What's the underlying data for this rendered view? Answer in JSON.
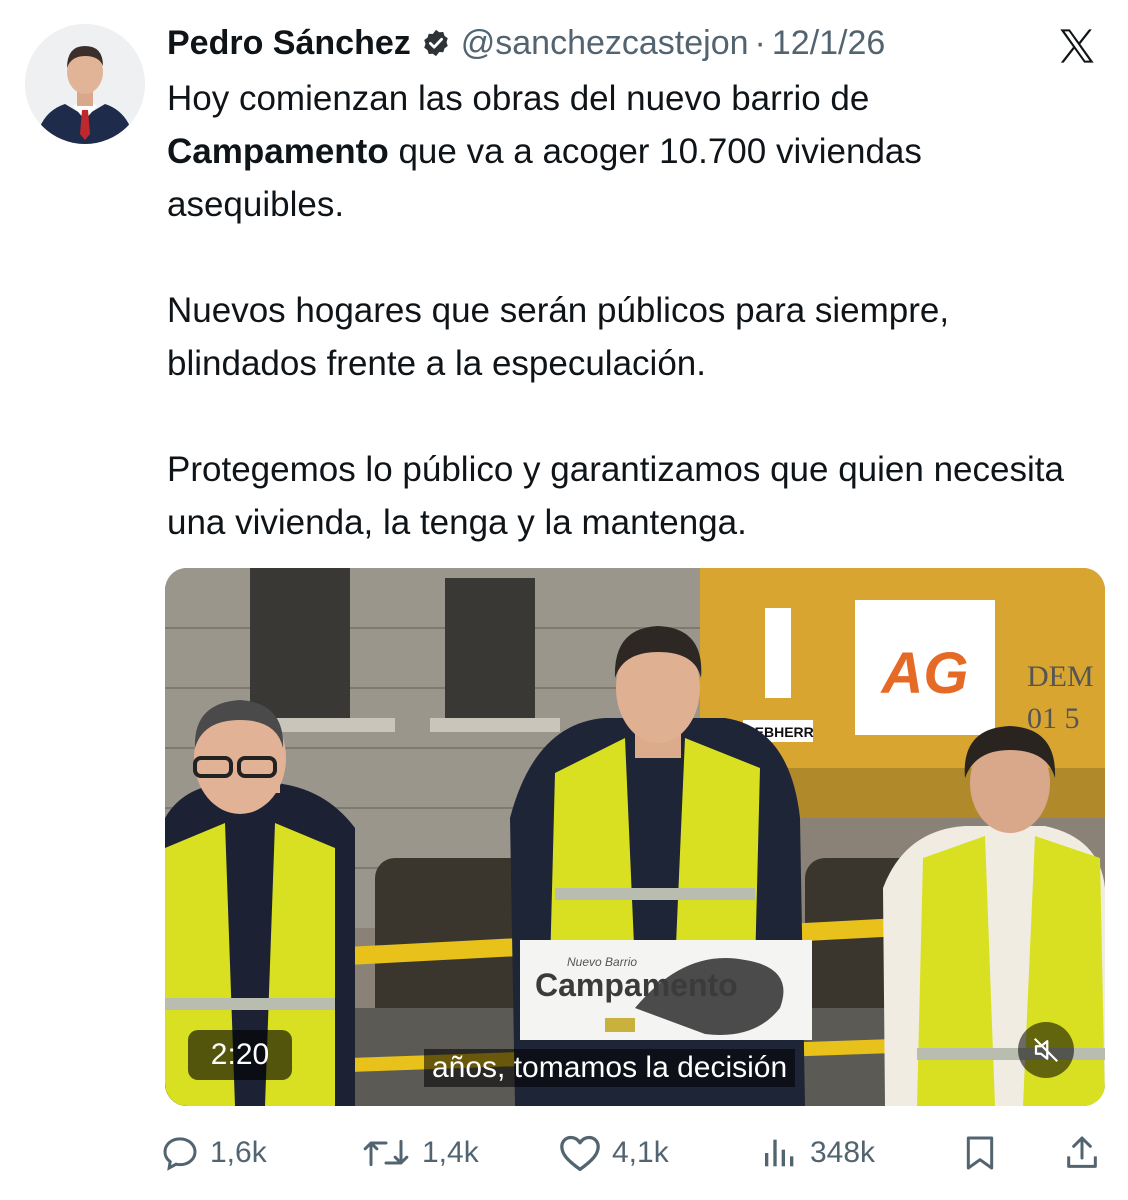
{
  "author": {
    "name": "Pedro Sánchez",
    "handle": "@sanchezcastejon",
    "separator": "·",
    "date": "12/1/26"
  },
  "icons": {
    "verified": "verified-badge-icon",
    "platform": "x-logo-icon",
    "reply": "reply-icon",
    "retweet": "retweet-icon",
    "like": "like-icon",
    "views": "views-icon",
    "bookmark": "bookmark-icon",
    "share": "share-icon",
    "mute": "mute-icon"
  },
  "tweet": {
    "p1_a": "Hoy comienzan las obras del nuevo barrio de ",
    "p1_bold": "Campamento",
    "p1_b": " que va a acoger 10.700 viviendas asequibles.",
    "p2": "Nuevos hogares que serán públicos para siempre, blindados frente a la especulación.",
    "p3": "Protegemos lo público y garantizamos que quien necesita una vivienda, la tenga y la mantenga."
  },
  "media": {
    "duration": "2:20",
    "subtitle": "años, tomamos la decisión",
    "podium_small": "Nuevo Barrio",
    "podium_title": "Campamento",
    "sign_logo": "AG",
    "sign_dem": "DEM",
    "sign_num": "01 5",
    "machine_brand": "LIEBHERR"
  },
  "metrics": {
    "replies": "1,6k",
    "retweets": "1,4k",
    "likes": "4,1k",
    "views": "348k"
  },
  "colors": {
    "verified": "#2f3336",
    "muted_text": "#536471",
    "vest": "#d9e021",
    "excavator": "#d8a530"
  }
}
